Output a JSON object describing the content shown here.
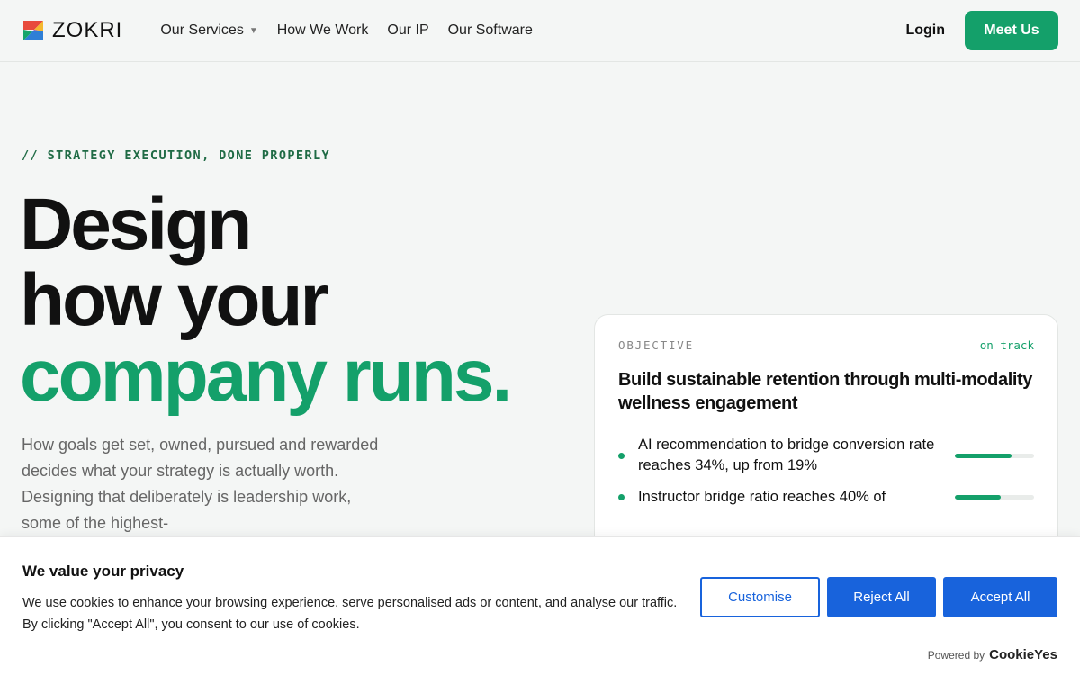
{
  "header": {
    "logo_text": "ZOKRI",
    "nav": [
      {
        "label": "Our Services",
        "has_caret": true
      },
      {
        "label": "How We Work"
      },
      {
        "label": "Our IP"
      },
      {
        "label": "Our Software"
      }
    ],
    "login_label": "Login",
    "cta_label": "Meet Us"
  },
  "hero": {
    "eyebrow": "// STRATEGY EXECUTION, DONE PROPERLY",
    "headline_line1": "Design",
    "headline_line2": "how your",
    "headline_line3": "company runs.",
    "lede": "How goals get set, owned, pursued and rewarded decides what your strategy is actually worth. Designing that deliberately is leadership work, some of the highest-"
  },
  "objective_card": {
    "label": "OBJECTIVE",
    "status": "on track",
    "title": "Build sustainable retention through multi-modality wellness engagement",
    "key_results": [
      {
        "text": "AI recommendation to bridge conversion rate reaches 34%, up from 19%",
        "progress": 0.72
      },
      {
        "text": "Instructor bridge ratio reaches 40% of",
        "progress": 0.58
      }
    ]
  },
  "cookie_banner": {
    "title": "We value your privacy",
    "text": "We use cookies to enhance your browsing experience, serve personalised ads or content, and analyse our traffic. By clicking \"Accept All\", you consent to our use of cookies.",
    "customise_label": "Customise",
    "reject_label": "Reject All",
    "accept_label": "Accept All",
    "powered_by": "Powered by",
    "powered_brand": "CookieYes"
  },
  "colors": {
    "brand_green": "#14a06a",
    "cookie_blue": "#1863dc"
  }
}
